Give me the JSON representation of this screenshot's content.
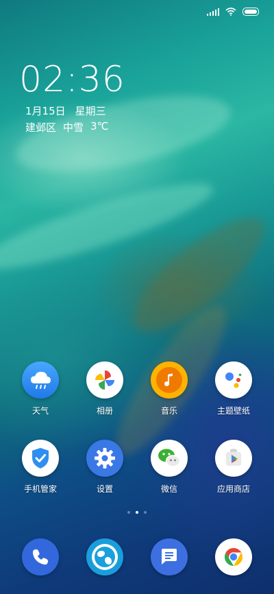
{
  "status_bar": {
    "signal_icon": "signal-icon",
    "wifi_icon": "wifi-icon",
    "battery_icon": "battery-icon"
  },
  "lockscreen_widget": {
    "time": "02:36",
    "date": "1月15日",
    "weekday": "星期三",
    "location": "建邺区",
    "weather": "中雪",
    "temperature": "3℃"
  },
  "apps": [
    {
      "label": "天气",
      "icon": "weather-icon",
      "color": "#2f8ef0"
    },
    {
      "label": "相册",
      "icon": "photos-pinwheel-icon",
      "color": "#ffffff"
    },
    {
      "label": "音乐",
      "icon": "music-note-icon",
      "color": "#ffb300"
    },
    {
      "label": "主题壁纸",
      "icon": "assistant-dots-icon",
      "color": "#ffffff"
    },
    {
      "label": "手机管家",
      "icon": "shield-check-icon",
      "color": "#ffffff"
    },
    {
      "label": "设置",
      "icon": "gear-icon",
      "color": "#3a78e6"
    },
    {
      "label": "微信",
      "icon": "wechat-icon",
      "color": "#ffffff"
    },
    {
      "label": "应用商店",
      "icon": "play-store-icon",
      "color": "#ffffff"
    }
  ],
  "page_indicator": {
    "pages": 3,
    "active": 2
  },
  "dock": [
    {
      "name": "phone",
      "icon": "phone-icon",
      "color": "#3268dc"
    },
    {
      "name": "browser",
      "icon": "globe-icon",
      "color": "#1a9edb"
    },
    {
      "name": "messages",
      "icon": "message-icon",
      "color": "#3d6fe0"
    },
    {
      "name": "chrome",
      "icon": "chrome-icon",
      "color": "#ffffff"
    }
  ]
}
